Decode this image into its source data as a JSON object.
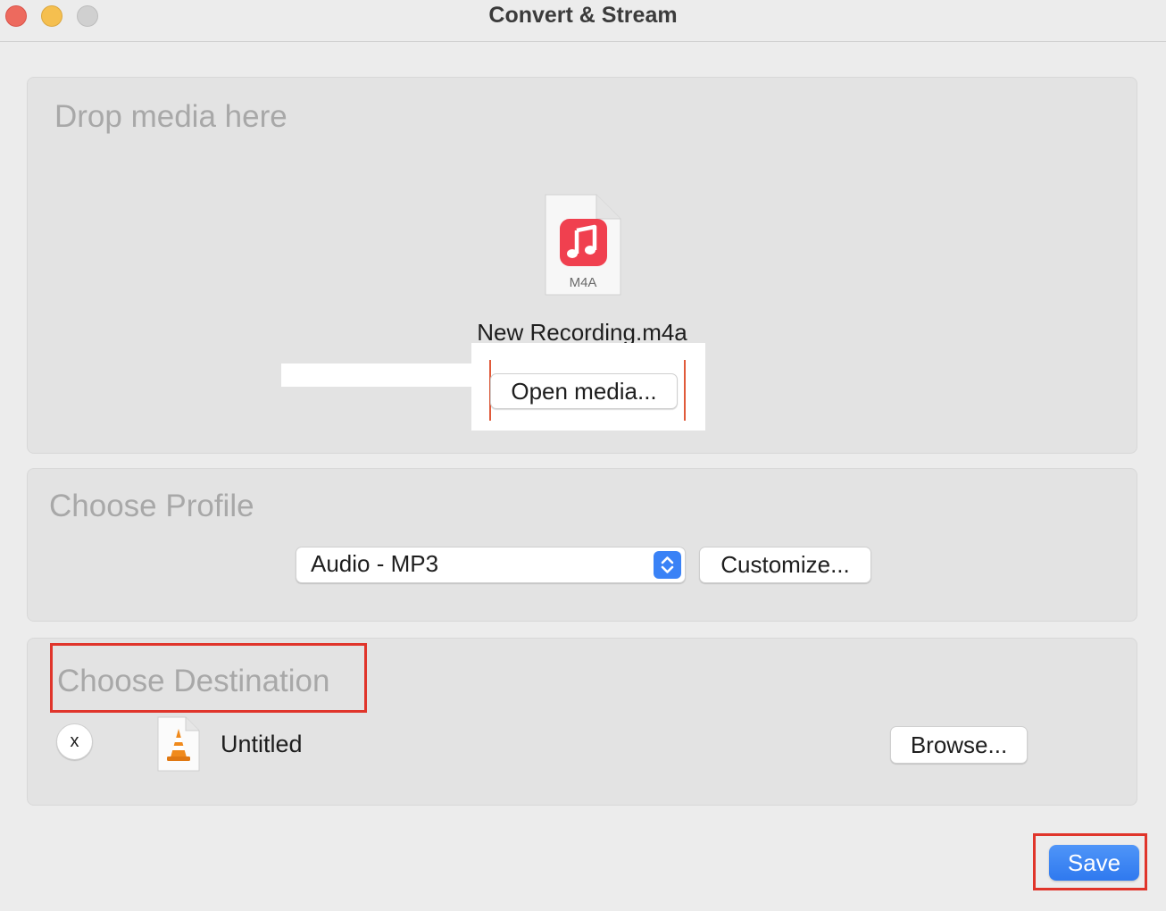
{
  "window": {
    "title": "Convert & Stream"
  },
  "drop_panel": {
    "heading": "Drop media here",
    "file_name": "New Recording.m4a",
    "file_type_label": "M4A",
    "open_button": "Open media..."
  },
  "profile_panel": {
    "heading": "Choose Profile",
    "selected_profile": "Audio - MP3",
    "customize_button": "Customize..."
  },
  "destination_panel": {
    "heading": "Choose Destination",
    "clear_button": "x",
    "file_name": "Untitled",
    "browse_button": "Browse..."
  },
  "save_button": "Save",
  "colors": {
    "accent": "#3a82f6",
    "highlight_box": "#e0352b",
    "music_icon": "#f0404f"
  }
}
